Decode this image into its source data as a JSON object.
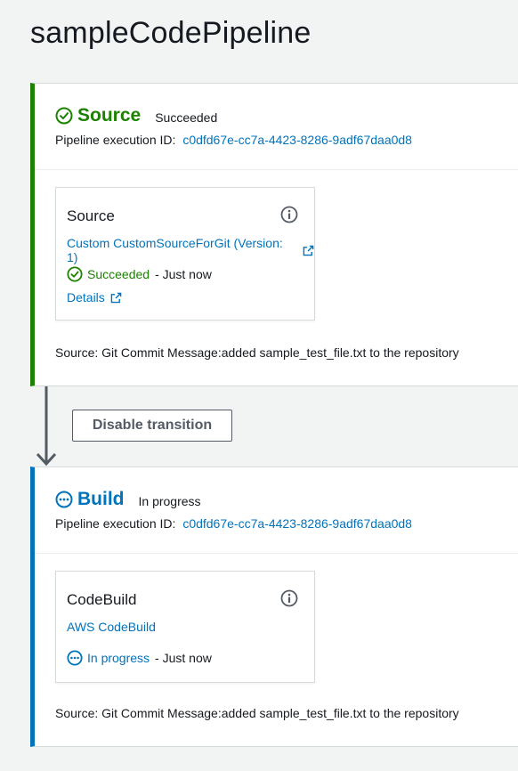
{
  "page": {
    "title": "sampleCodePipeline"
  },
  "colors": {
    "succeeded": "#1d8102",
    "in_progress": "#0073bb",
    "link": "#0073bb",
    "background": "#f2f3f3"
  },
  "stages": {
    "source": {
      "name": "Source",
      "status": "Succeeded",
      "status_icon": "check-circle-icon",
      "execution_label": "Pipeline execution ID:",
      "execution_id": "c0dfd67e-cc7a-4423-8286-9adf67daa0d8",
      "action": {
        "title": "Source",
        "provider": "Custom CustomSourceForGit (Version: 1)",
        "status": "Succeeded",
        "time": "- Just now",
        "details_label": "Details"
      },
      "commit_message": "Source: Git Commit Message:added sample_test_file.txt to the repository"
    },
    "transition": {
      "button_label": "Disable transition"
    },
    "build": {
      "name": "Build",
      "status": "In progress",
      "status_icon": "in-progress-icon",
      "execution_label": "Pipeline execution ID:",
      "execution_id": "c0dfd67e-cc7a-4423-8286-9adf67daa0d8",
      "action": {
        "title": "CodeBuild",
        "provider": "AWS CodeBuild",
        "status": "In progress",
        "time": "- Just now"
      },
      "commit_message": "Source: Git Commit Message:added sample_test_file.txt to the repository"
    }
  }
}
